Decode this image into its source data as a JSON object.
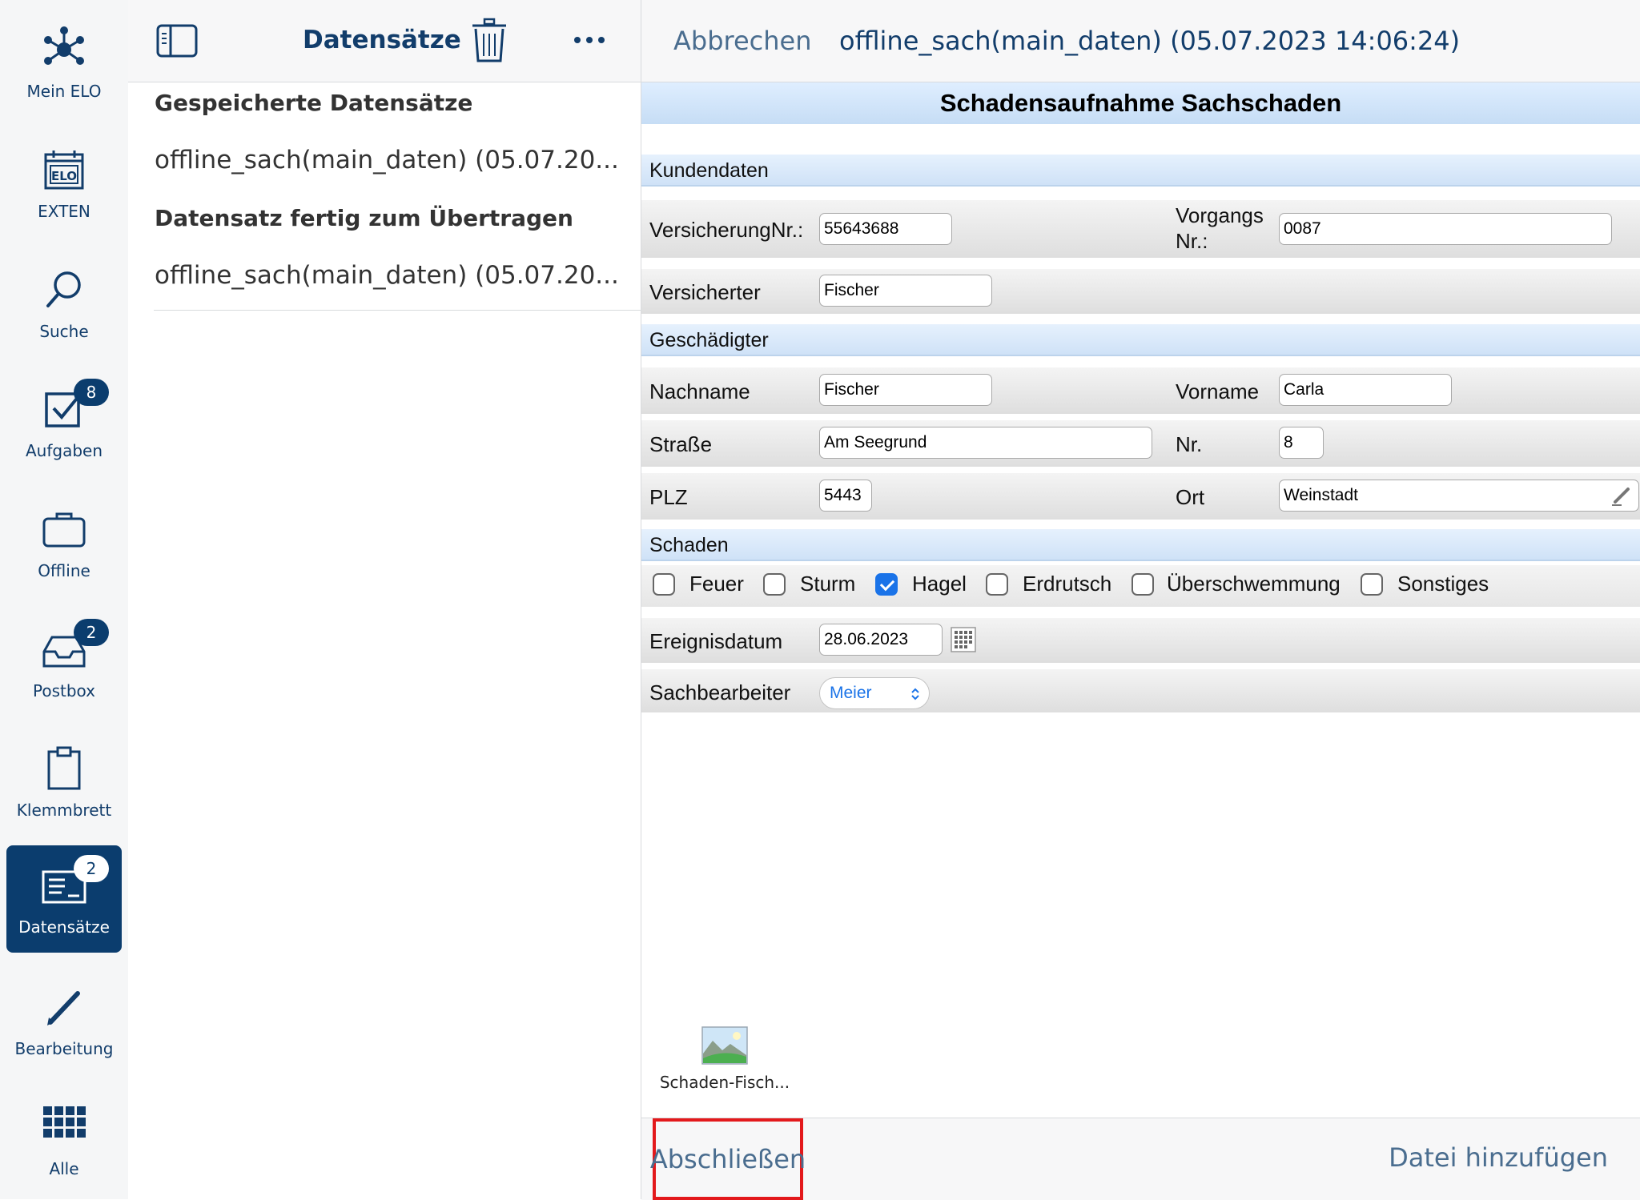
{
  "nav": {
    "items": [
      {
        "label": "Mein ELO",
        "icon": "network-icon"
      },
      {
        "label": "EXTEN",
        "icon": "elo-calendar-icon"
      },
      {
        "label": "Suche",
        "icon": "search-icon"
      },
      {
        "label": "Aufgaben",
        "icon": "checkbox-icon",
        "badge": "8"
      },
      {
        "label": "Offline",
        "icon": "briefcase-icon"
      },
      {
        "label": "Postbox",
        "icon": "inbox-icon",
        "badge": "2"
      },
      {
        "label": "Klemmbrett",
        "icon": "clipboard-icon"
      },
      {
        "label": "Datensätze",
        "icon": "records-icon",
        "badge": "2",
        "active": true
      },
      {
        "label": "Bearbeitung",
        "icon": "pencil-icon"
      },
      {
        "label": "Alle",
        "icon": "grid-icon"
      }
    ]
  },
  "list": {
    "title": "Datensätze",
    "saved_heading": "Gespeicherte Datensätze",
    "saved_item": "offline_sach(main_daten) (05.07.20...",
    "ready_heading": "Datensatz fertig zum Übertragen",
    "ready_item": "offline_sach(main_daten) (05.07.20..."
  },
  "detail": {
    "cancel": "Abbrechen",
    "record_title": "offline_sach(main_daten) (05.07.2023 14:06:24)",
    "form_title": "Schadensaufnahme Sachschaden",
    "customer_group": "Kundendaten",
    "insurance_no_label": "VersicherungNr.:",
    "insurance_no": "55643688",
    "process_no_label_1": "Vorgangs",
    "process_no_label_2": "Nr.:",
    "process_no": "0087",
    "insured_label": "Versicherter",
    "insured": "Fischer",
    "damaged_group": "Geschädigter",
    "lastname_label": "Nachname",
    "lastname": "Fischer",
    "firstname_label": "Vorname",
    "firstname": "Carla",
    "street_label": "Straße",
    "street": "Am Seegrund",
    "house_no_label": "Nr.",
    "house_no": "8",
    "zip_label": "PLZ",
    "zip": "5443",
    "city_label": "Ort",
    "city": "Weinstadt",
    "damage_group": "Schaden",
    "damage_types": [
      {
        "label": "Feuer",
        "checked": false
      },
      {
        "label": "Sturm",
        "checked": false
      },
      {
        "label": "Hagel",
        "checked": true
      },
      {
        "label": "Erdrutsch",
        "checked": false
      },
      {
        "label": "Überschwemmung",
        "checked": false
      },
      {
        "label": "Sonstiges",
        "checked": false
      }
    ],
    "event_date_label": "Ereignisdatum",
    "event_date": "28.06.2023",
    "clerk_label": "Sachbearbeiter",
    "clerk": "Meier",
    "attachment_name": "Schaden-Fisch...",
    "finish": "Abschließen",
    "add_file": "Datei hinzufügen"
  }
}
